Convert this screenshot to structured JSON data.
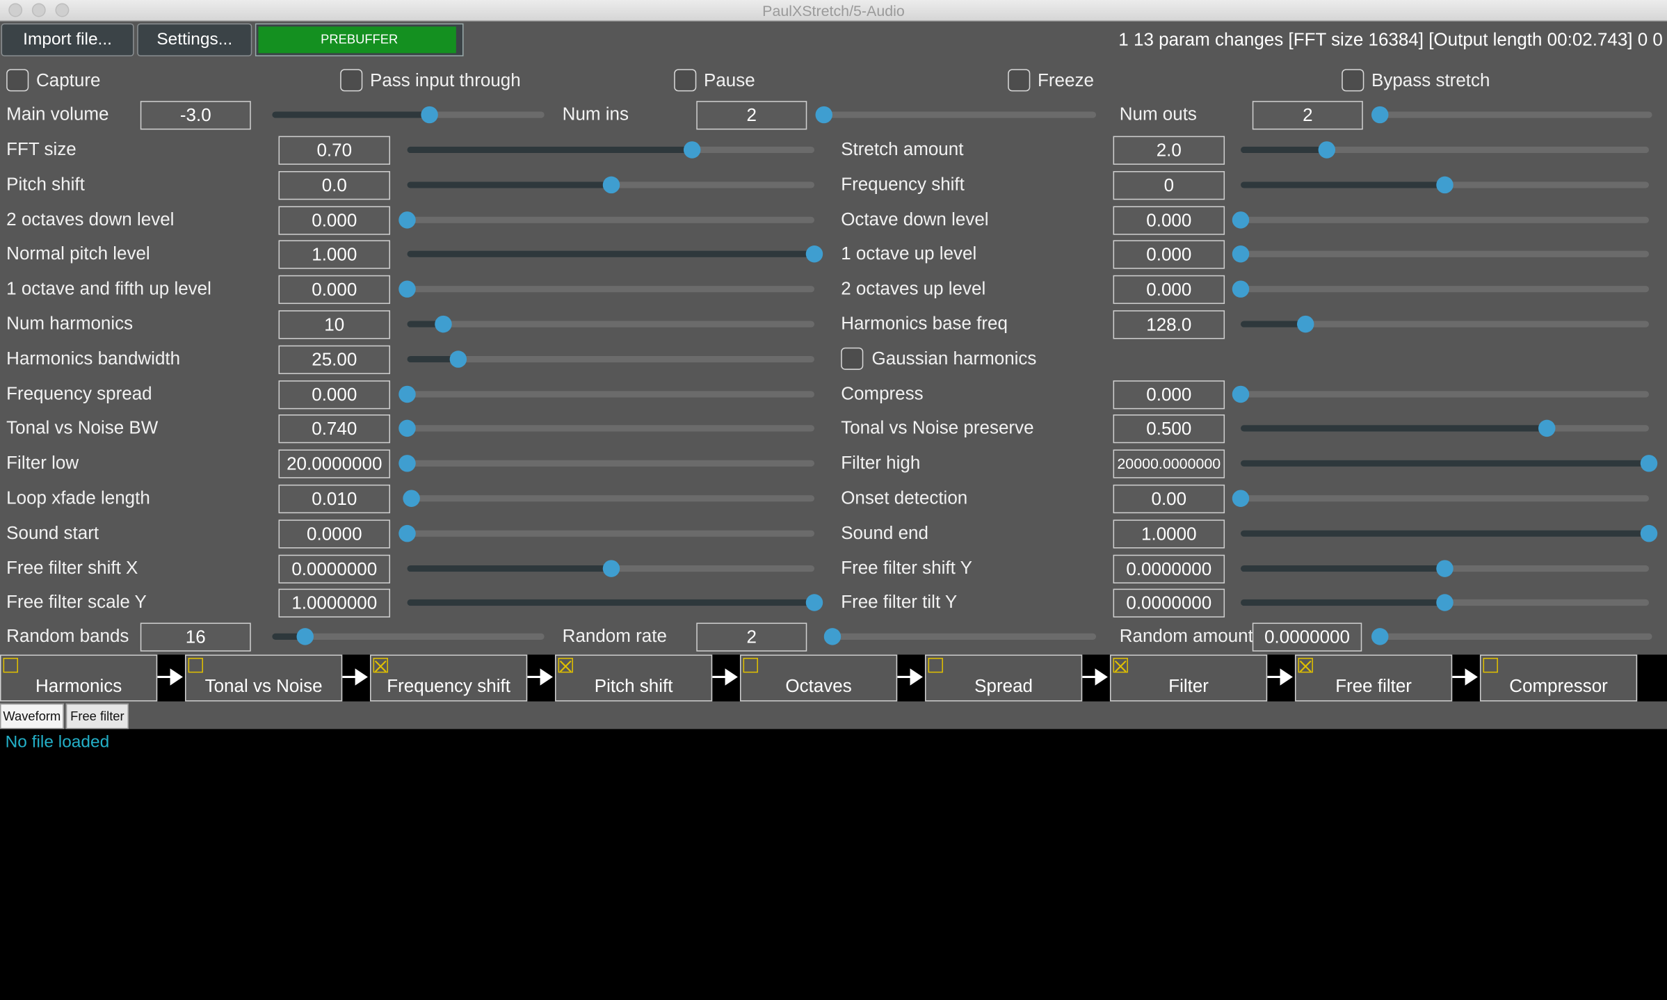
{
  "window": {
    "title": "PaulXStretch/5-Audio"
  },
  "toolbar": {
    "import_label": "Import file...",
    "settings_label": "Settings...",
    "prebuffer_label": "PREBUFFER",
    "prebuffer_fraction": 0.98,
    "status": "1 13 param changes  [FFT size 16384] [Output length 00:02.743] 0 0"
  },
  "checkboxes": [
    {
      "label": "Capture",
      "checked": false
    },
    {
      "label": "Pass input through",
      "checked": false
    },
    {
      "label": "Pause",
      "checked": false
    },
    {
      "label": "Freeze",
      "checked": false
    },
    {
      "label": "Bypass stretch",
      "checked": false
    }
  ],
  "io_row": [
    {
      "label": "Main volume",
      "value": "-3.0",
      "fraction": 0.58
    },
    {
      "label": "Num ins",
      "value": "2",
      "fraction": 0.0
    },
    {
      "label": "Num outs",
      "value": "2",
      "fraction": 0.0
    }
  ],
  "params_left": [
    {
      "label": "FFT size",
      "value": "0.70",
      "fraction": 0.7
    },
    {
      "label": "Pitch shift",
      "value": "0.0",
      "fraction": 0.5
    },
    {
      "label": "2 octaves down level",
      "value": "0.000",
      "fraction": 0.0
    },
    {
      "label": "Normal pitch level",
      "value": "1.000",
      "fraction": 1.0
    },
    {
      "label": "1 octave and fifth up level",
      "value": "0.000",
      "fraction": 0.0
    },
    {
      "label": "Num harmonics",
      "value": "10",
      "fraction": 0.09
    },
    {
      "label": "Harmonics bandwidth",
      "value": "25.00",
      "fraction": 0.125
    },
    {
      "label": "Frequency spread",
      "value": "0.000",
      "fraction": 0.0
    },
    {
      "label": "Tonal vs Noise BW",
      "value": "0.740",
      "fraction": 0.0
    },
    {
      "label": "Filter low",
      "value": "20.0000000",
      "fraction": 0.0
    },
    {
      "label": "Loop xfade length",
      "value": "0.010",
      "fraction": 0.01
    },
    {
      "label": "Sound start",
      "value": "0.0000",
      "fraction": 0.0
    },
    {
      "label": "Free filter shift X",
      "value": "0.0000000",
      "fraction": 0.5
    },
    {
      "label": "Free filter scale Y",
      "value": "1.0000000",
      "fraction": 1.0
    }
  ],
  "params_right": [
    {
      "label": "Stretch amount",
      "value": "2.0",
      "fraction": 0.21
    },
    {
      "label": "Frequency shift",
      "value": "0",
      "fraction": 0.5
    },
    {
      "label": "Octave down level",
      "value": "0.000",
      "fraction": 0.0
    },
    {
      "label": "1 octave up level",
      "value": "0.000",
      "fraction": 0.0
    },
    {
      "label": "2 octaves up level",
      "value": "0.000",
      "fraction": 0.0
    },
    {
      "label": "Harmonics base freq",
      "value": "128.0",
      "fraction": 0.16
    },
    {
      "label": "Gaussian harmonics",
      "checkbox": true,
      "checked": false
    },
    {
      "label": "Compress",
      "value": "0.000",
      "fraction": 0.0
    },
    {
      "label": "Tonal vs Noise preserve",
      "value": "0.500",
      "fraction": 0.75
    },
    {
      "label": "Filter high",
      "value": "20000.0000000",
      "fraction": 1.0
    },
    {
      "label": "Onset detection",
      "value": "0.00",
      "fraction": 0.0
    },
    {
      "label": "Sound end",
      "value": "1.0000",
      "fraction": 1.0
    },
    {
      "label": "Free filter shift Y",
      "value": "0.0000000",
      "fraction": 0.5
    },
    {
      "label": "Free filter tilt Y",
      "value": "0.0000000",
      "fraction": 0.5
    }
  ],
  "random_row": [
    {
      "label": "Random bands",
      "value": "16",
      "fraction": 0.12
    },
    {
      "label": "Random rate",
      "value": "2",
      "fraction": 0.03
    },
    {
      "label": "Random amount",
      "value": "0.0000000",
      "fraction": 0.0
    }
  ],
  "modules": [
    {
      "label": "Harmonics",
      "enabled": false
    },
    {
      "label": "Tonal vs Noise",
      "enabled": false
    },
    {
      "label": "Frequency shift",
      "enabled": true
    },
    {
      "label": "Pitch shift",
      "enabled": true
    },
    {
      "label": "Octaves",
      "enabled": false
    },
    {
      "label": "Spread",
      "enabled": false
    },
    {
      "label": "Filter",
      "enabled": true
    },
    {
      "label": "Free filter",
      "enabled": true
    },
    {
      "label": "Compressor",
      "enabled": false
    }
  ],
  "tabs": [
    {
      "label": "Waveform",
      "active": true
    },
    {
      "label": "Free filter",
      "active": false
    }
  ],
  "waveform": {
    "message": "No file loaded"
  },
  "colors": {
    "background": "#575757",
    "slider_thumb": "#3f9ed0",
    "prebuffer": "#149020",
    "message": "#23b0c8",
    "module_checkbox": "#e0c000"
  }
}
